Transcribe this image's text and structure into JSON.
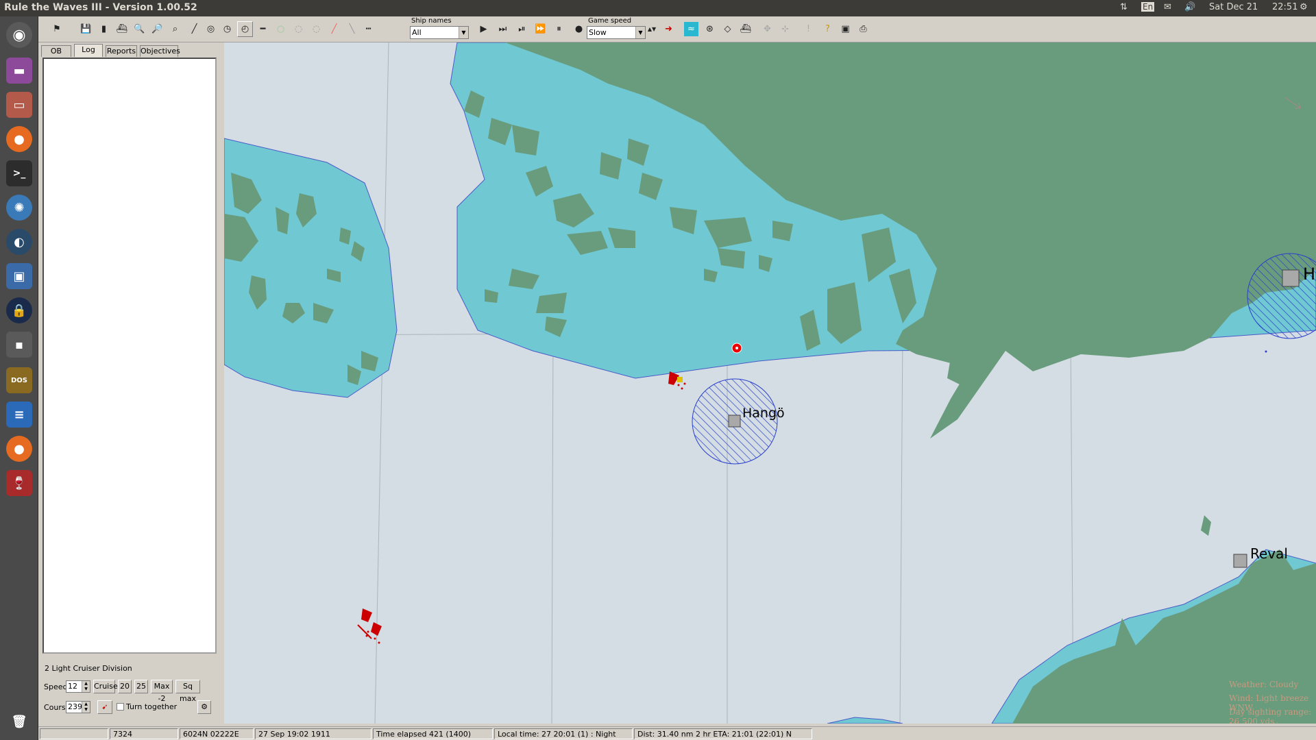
{
  "window": {
    "title": "Rule the Waves III - Version 1.00.52"
  },
  "top_panel": {
    "keyboard": "En",
    "datetime": "Sat Dec 21",
    "time": "22:51"
  },
  "toolbar": {
    "ship_names_label": "Ship names",
    "ship_names_value": "All",
    "game_speed_label": "Game speed",
    "game_speed_value": "Slow"
  },
  "left_panel": {
    "tabs": [
      "OB",
      "Log",
      "Reports",
      "Objectives"
    ],
    "division_name": "2 Light Cruiser Division",
    "speed_label": "Speed",
    "speed_value": "12",
    "speed_buttons": [
      "Cruise",
      "20",
      "25",
      "Max -2",
      "Sq max"
    ],
    "course_label": "Course",
    "course_value": "239",
    "turn_together_label": "Turn together"
  },
  "map": {
    "places": [
      {
        "name": "Hangö"
      },
      {
        "name": "Helsin"
      },
      {
        "name": "Reval"
      }
    ],
    "weather": [
      "Weather: Cloudy",
      "Wind: Light breeze  WNW",
      "Day sighting range: 26,500 yds",
      "Night sighting range: 4,000 yds"
    ],
    "colors": {
      "sea": "#d3dde3",
      "shallow": "#6fc8d2",
      "land": "#699b7d",
      "enemy": "#cc0000"
    }
  },
  "statusbar": {
    "cells": [
      "",
      "7324",
      "6024N 02222E",
      "27 Sep 19:02 1911",
      "Time elapsed 421 (1400)",
      "Local time: 27 20:01 (1) : Night",
      "Dist: 31.40 nm 2 hr ETA: 21:01 (22:01) N"
    ]
  }
}
